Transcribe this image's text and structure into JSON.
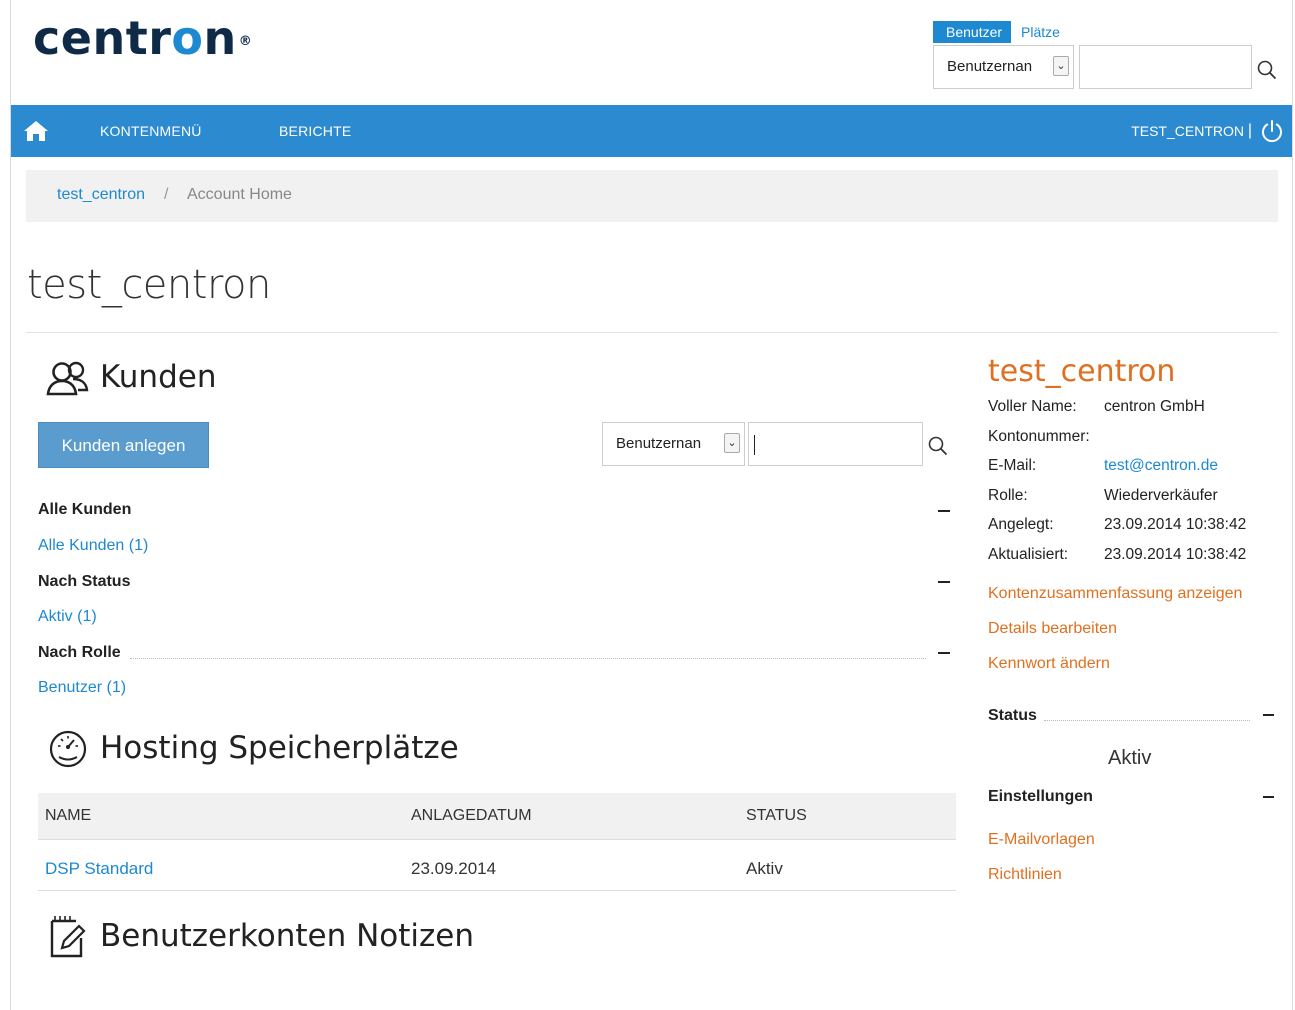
{
  "brand": {
    "logo_pre": "centr",
    "logo_hl": "o",
    "logo_post": "n",
    "reg": "®"
  },
  "top_search": {
    "tabs": [
      "Benutzer",
      "Plätze"
    ],
    "field_select": "Benutzernan",
    "query": ""
  },
  "nav": {
    "items": [
      "KONTENMENÜ",
      "BERICHTE"
    ],
    "user": "TEST_CENTRON",
    "separator": "|"
  },
  "breadcrumb": {
    "account": "test_centron",
    "separator": "/",
    "current": "Account Home"
  },
  "page_title": "test_centron",
  "kunden": {
    "title": "Kunden",
    "create_button": "Kunden anlegen",
    "search_select": "Benutzernan",
    "search_query": "",
    "groups": [
      {
        "heading": "Alle Kunden",
        "link": "Alle Kunden (1)"
      },
      {
        "heading": "Nach Status",
        "link": "Aktiv (1)"
      },
      {
        "heading": "Nach Rolle",
        "link": "Benutzer (1)"
      }
    ]
  },
  "hosting": {
    "title": "Hosting Speicherplätze",
    "columns": [
      "NAME",
      "ANLAGEDATUM",
      "STATUS"
    ],
    "rows": [
      {
        "name": "DSP Standard",
        "date": "23.09.2014",
        "status": "Aktiv"
      }
    ]
  },
  "notes": {
    "title": "Benutzerkonten Notizen"
  },
  "account_panel": {
    "name": "test_centron",
    "fields": [
      {
        "label": "Voller Name:",
        "value": "centron GmbH"
      },
      {
        "label": "Kontonummer:",
        "value": ""
      },
      {
        "label": "E-Mail:",
        "value": "test@centron.de"
      },
      {
        "label": "Rolle:",
        "value": "Wiederverkäufer"
      },
      {
        "label": "Angelegt:",
        "value": "23.09.2014 10:38:42"
      },
      {
        "label": "Aktualisiert:",
        "value": "23.09.2014 10:38:42"
      }
    ],
    "actions": [
      "Kontenzusammenfassung anzeigen",
      "Details bearbeiten",
      "Kennwort ändern"
    ],
    "status_heading": "Status",
    "status_value": "Aktiv",
    "settings_heading": "Einstellungen",
    "settings_links": [
      "E-Mailvorlagen",
      "Richtlinien"
    ]
  },
  "colors": {
    "brand_blue": "#1d89d0",
    "navbar": "#2b8ad0",
    "accent_orange": "#e07020",
    "logo_dark": "#0e2a47"
  },
  "icons": [
    "search-icon",
    "home-icon",
    "power-icon",
    "users-icon",
    "gauge-icon",
    "notepad-icon",
    "chevron-down-icon"
  ]
}
